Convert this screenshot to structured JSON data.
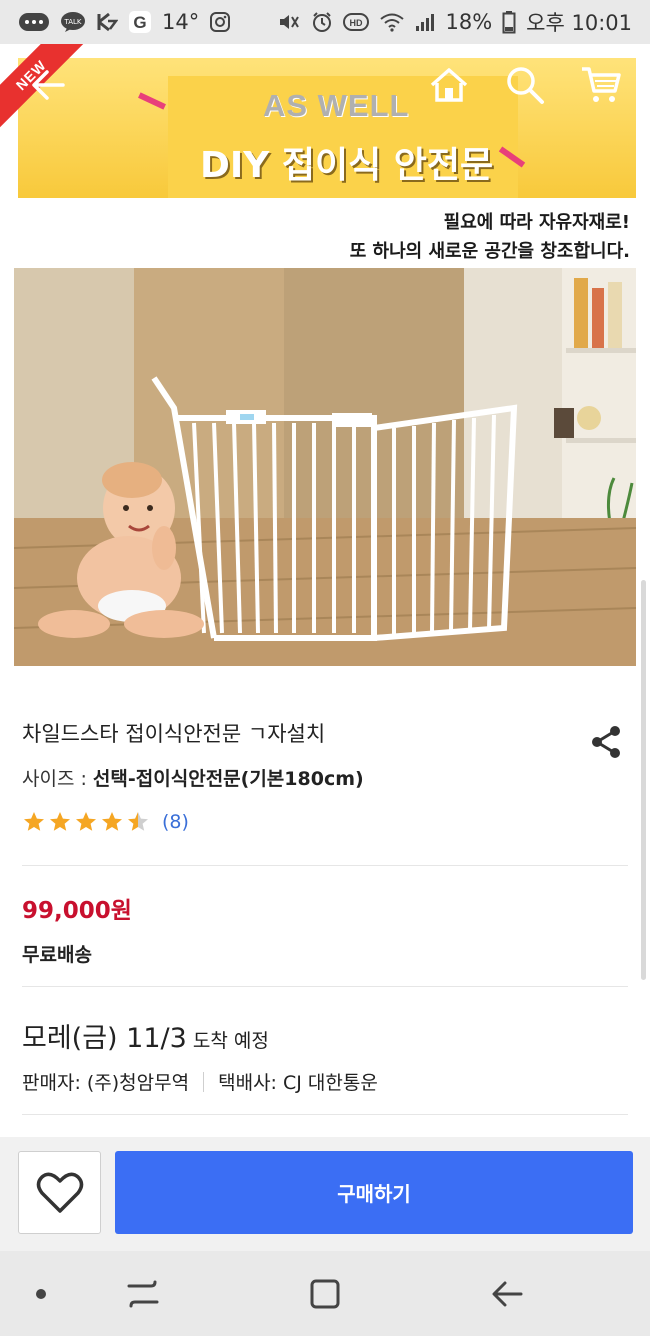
{
  "status_bar": {
    "temperature": "14°",
    "battery": "18%",
    "time": "오후 10:01"
  },
  "hero": {
    "new_badge": "NEW",
    "banner_brand": "AS WELL",
    "banner_title": "DIY 접이식 안전문",
    "tagline_line1": "필요에 따라 자유자재로!",
    "tagline_line2": "또 하나의 새로운 공간을 창조합니다."
  },
  "product": {
    "title": "차일드스타 접이식안전문 ㄱ자설치",
    "option_label": "사이즈 : ",
    "option_value": "선택-접이식안전문(기본180cm)",
    "rating": 4.5,
    "review_count": "(8)",
    "price": "99,000원",
    "shipping": "무료배송",
    "arrival_main": "모레(금) 11/3",
    "arrival_sub": " 도착 예정",
    "seller": "판매자: (주)청암무역",
    "courier": "택배사: CJ 대한통운"
  },
  "actions": {
    "buy_label": "구매하기"
  },
  "colors": {
    "accent": "#3b6ef4",
    "price": "#c8102e",
    "star": "#f5a623"
  }
}
